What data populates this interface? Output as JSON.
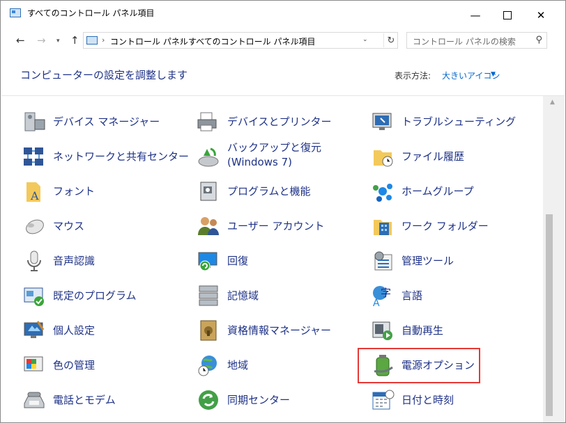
{
  "window": {
    "title": "すべてのコントロール パネル項目"
  },
  "address": {
    "breadcrumbs": [
      "コントロール パネル",
      "すべてのコントロール パネル項目"
    ]
  },
  "search": {
    "placeholder": "コントロール パネルの検索"
  },
  "header": {
    "title": "コンピューターの設定を調整します",
    "view_by_label": "表示方法:",
    "view_by_value": "大きいアイコン"
  },
  "items": [
    {
      "label": "デバイス マネージャー",
      "icon": "device-manager-icon"
    },
    {
      "label": "デバイスとプリンター",
      "icon": "devices-printers-icon"
    },
    {
      "label": "トラブルシューティング",
      "icon": "troubleshooting-icon"
    },
    {
      "label": "ネットワークと共有センター",
      "icon": "network-sharing-icon"
    },
    {
      "label": "バックアップと復元 (Windows 7)",
      "icon": "backup-restore-icon"
    },
    {
      "label": "ファイル履歴",
      "icon": "file-history-icon"
    },
    {
      "label": "フォント",
      "icon": "fonts-icon"
    },
    {
      "label": "プログラムと機能",
      "icon": "programs-features-icon"
    },
    {
      "label": "ホームグループ",
      "icon": "homegroup-icon"
    },
    {
      "label": "マウス",
      "icon": "mouse-icon"
    },
    {
      "label": "ユーザー アカウント",
      "icon": "user-accounts-icon"
    },
    {
      "label": "ワーク フォルダー",
      "icon": "work-folders-icon"
    },
    {
      "label": "音声認識",
      "icon": "speech-recognition-icon"
    },
    {
      "label": "回復",
      "icon": "recovery-icon"
    },
    {
      "label": "管理ツール",
      "icon": "admin-tools-icon"
    },
    {
      "label": "既定のプログラム",
      "icon": "default-programs-icon"
    },
    {
      "label": "記憶域",
      "icon": "storage-spaces-icon"
    },
    {
      "label": "言語",
      "icon": "language-icon"
    },
    {
      "label": "個人設定",
      "icon": "personalization-icon"
    },
    {
      "label": "資格情報マネージャー",
      "icon": "credential-manager-icon"
    },
    {
      "label": "自動再生",
      "icon": "autoplay-icon"
    },
    {
      "label": "色の管理",
      "icon": "color-management-icon"
    },
    {
      "label": "地域",
      "icon": "region-icon"
    },
    {
      "label": "電源オプション",
      "icon": "power-options-icon"
    },
    {
      "label": "電話とモデム",
      "icon": "phone-modem-icon"
    },
    {
      "label": "同期センター",
      "icon": "sync-center-icon"
    },
    {
      "label": "日付と時刻",
      "icon": "date-time-icon"
    }
  ],
  "highlighted_item": "電源オプション",
  "colors": {
    "link": "#1e3287",
    "accent": "#0066cc",
    "highlight": "#e53935"
  }
}
